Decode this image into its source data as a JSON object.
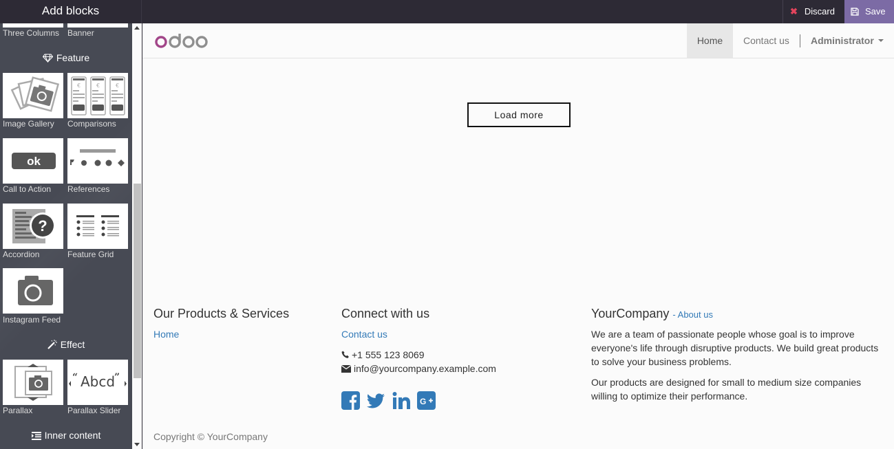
{
  "topbar": {
    "title": "Add blocks",
    "discard_label": "Discard",
    "save_label": "Save",
    "save_color": "#7c6ba5"
  },
  "sidebar": {
    "partial_items": [
      {
        "label": "Three Columns"
      },
      {
        "label": "Banner"
      }
    ],
    "categories": [
      {
        "name": "Feature",
        "icon": "diamond-icon",
        "items": [
          {
            "label": "Image Gallery",
            "icon": "image-gallery-thumbnail"
          },
          {
            "label": "Comparisons",
            "icon": "comparisons-thumbnail"
          },
          {
            "label": "Call to Action",
            "icon": "call-to-action-thumbnail",
            "thumb_text": "ok"
          },
          {
            "label": "References",
            "icon": "references-thumbnail"
          },
          {
            "label": "Accordion",
            "icon": "accordion-thumbnail"
          },
          {
            "label": "Feature Grid",
            "icon": "feature-grid-thumbnail"
          },
          {
            "label": "Instagram Feed",
            "icon": "camera-thumbnail"
          }
        ]
      },
      {
        "name": "Effect",
        "icon": "magic-wand-icon",
        "items": [
          {
            "label": "Parallax",
            "icon": "parallax-thumbnail"
          },
          {
            "label": "Parallax Slider",
            "icon": "parallax-slider-thumbnail",
            "thumb_text": "Abcd"
          }
        ]
      },
      {
        "name": "Inner content",
        "icon": "indent-list-icon",
        "items": []
      }
    ]
  },
  "navbar": {
    "logo_text": "odoo",
    "items": [
      {
        "label": "Home",
        "active": true
      },
      {
        "label": "Contact us",
        "active": false
      }
    ],
    "user_menu": "Administrator"
  },
  "content": {
    "load_more_label": "Load more"
  },
  "footer": {
    "col1": {
      "heading": "Our Products & Services",
      "links": [
        "Home"
      ]
    },
    "col2": {
      "heading": "Connect with us",
      "link": "Contact us",
      "phone": "+1 555 123 8069",
      "email": "info@yourcompany.example.com",
      "social": [
        "facebook-icon",
        "twitter-icon",
        "linkedin-icon",
        "google-plus-icon"
      ]
    },
    "col3": {
      "heading": "YourCompany",
      "separator": "- ",
      "about_link": "About us",
      "para1": "We are a team of passionate people whose goal is to improve everyone's life through disruptive products. We build great products to solve your business problems.",
      "para2": "Our products are designed for small to medium size companies willing to optimize their performance."
    },
    "copyright": "Copyright © YourCompany"
  },
  "colors": {
    "link": "#337ab7",
    "logo_accent": "#a24689",
    "topbar_bg": "#2d2a35",
    "sidebar_bg": "#474a54"
  }
}
